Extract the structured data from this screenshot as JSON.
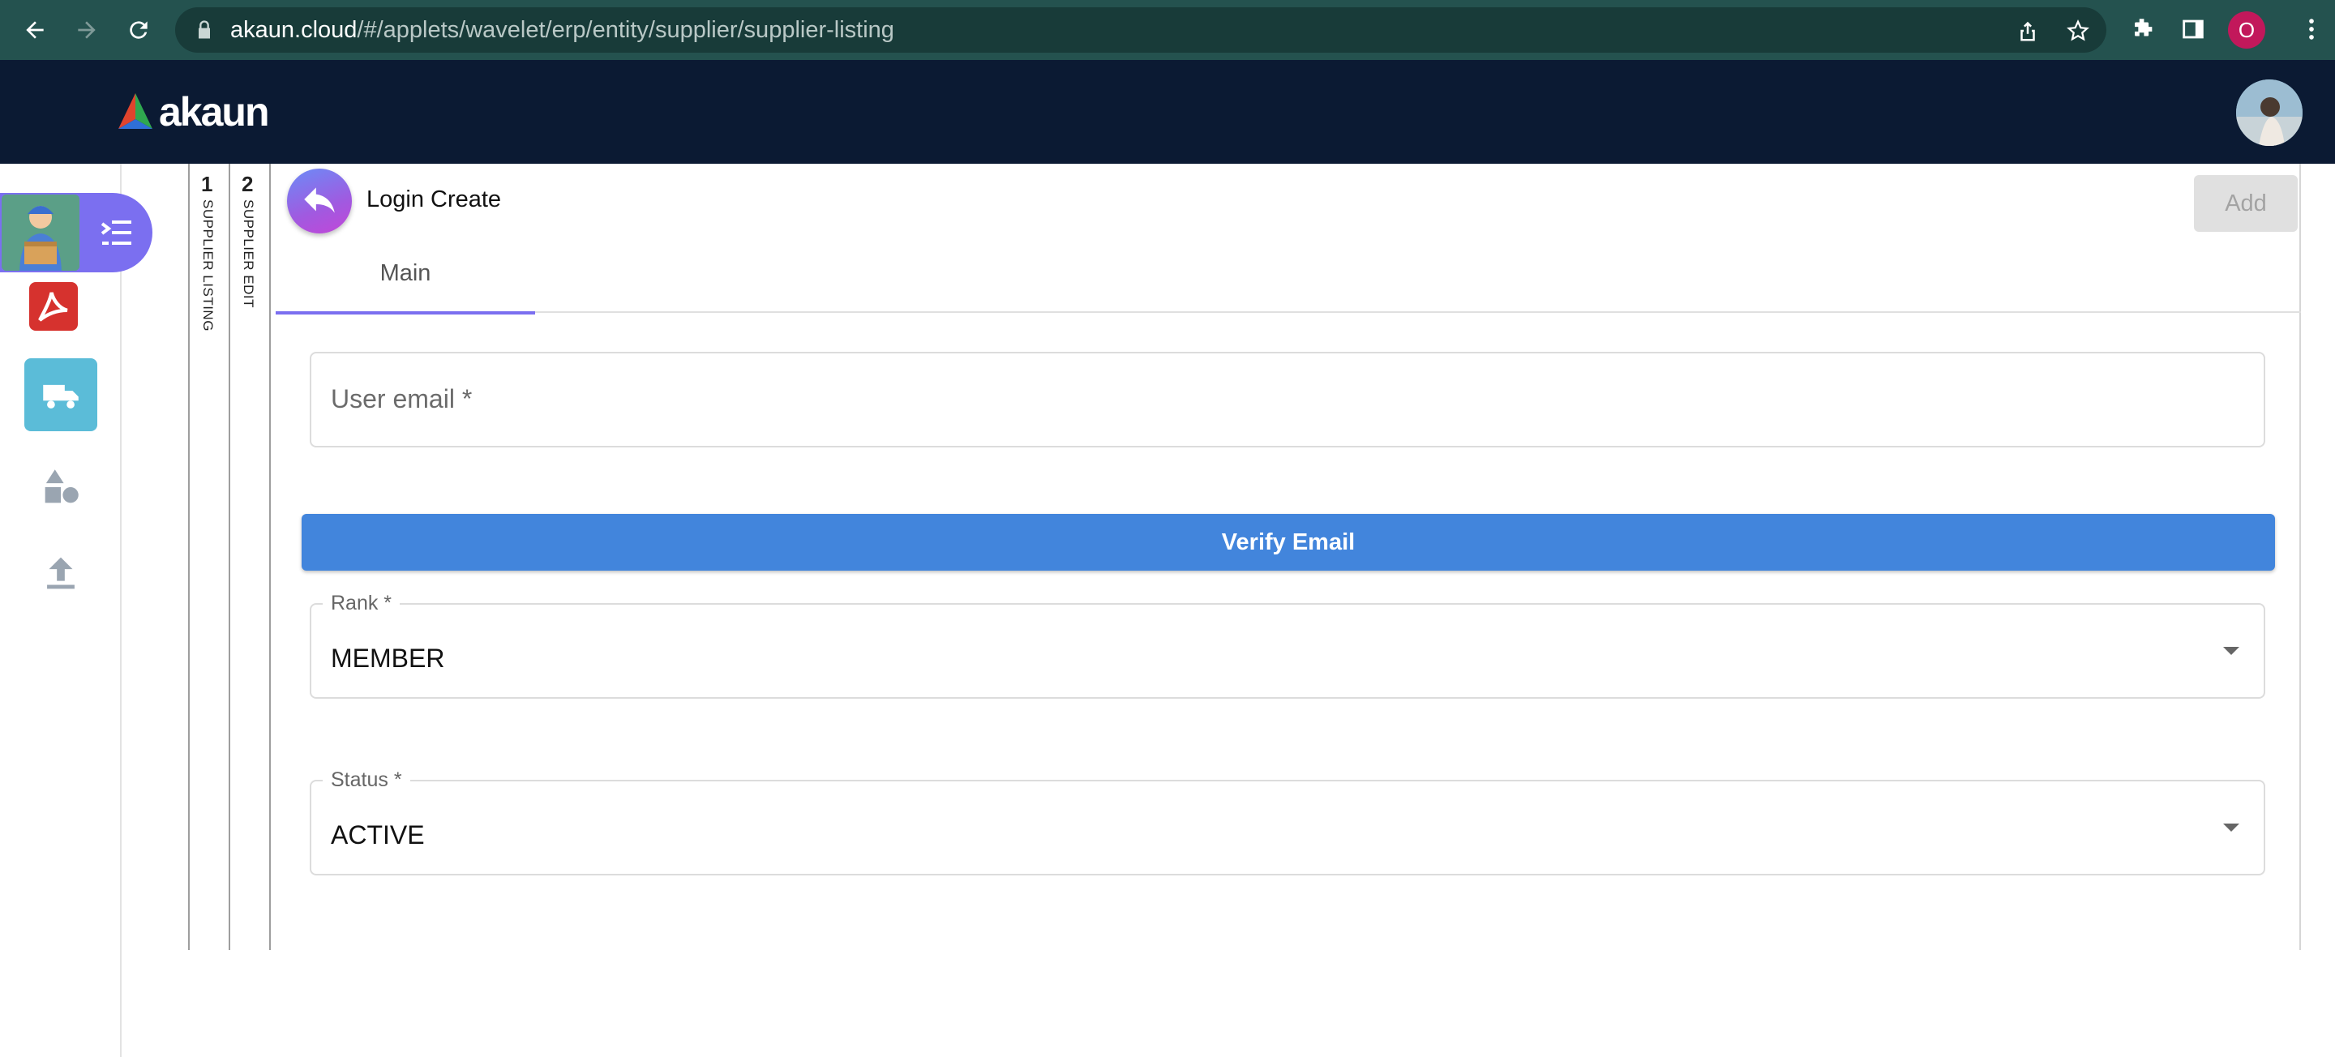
{
  "browser": {
    "url_host": "akaun.cloud",
    "url_path": "/#/applets/wavelet/erp/entity/supplier/supplier-listing",
    "profile_initial": "O",
    "profile_color": "#c2185b"
  },
  "header": {
    "brand": "akaun",
    "bg_color": "#0b1a33"
  },
  "sidebar": {
    "accent": "#7b6ff0",
    "items": [
      {
        "icon": "delivery-person-icon",
        "active": true
      },
      {
        "icon": "acrobat-icon"
      },
      {
        "icon": "truck-icon"
      },
      {
        "icon": "shapes-icon"
      },
      {
        "icon": "upload-icon"
      }
    ]
  },
  "steps": [
    {
      "num": "1",
      "label": "SUPPLIER LISTING"
    },
    {
      "num": "2",
      "label": "SUPPLIER EDIT"
    }
  ],
  "panel": {
    "title": "Login Create",
    "add_label": "Add",
    "tabs": [
      {
        "label": "Main",
        "active": true
      }
    ],
    "email_placeholder": "User email *",
    "verify_label": "Verify Email",
    "rank": {
      "label": "Rank *",
      "value": "MEMBER"
    },
    "status": {
      "label": "Status *",
      "value": "ACTIVE"
    },
    "primary_color": "#4285dc"
  }
}
